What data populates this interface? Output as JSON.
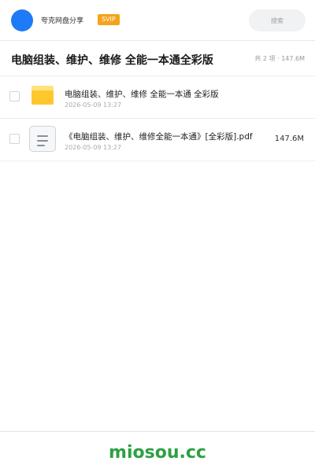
{
  "header": {
    "brand": "夸克网盘分享",
    "badge": "SVIP",
    "search_placeholder": "搜索"
  },
  "share": {
    "title": "电脑组装、维护、维修 全能一本通全彩版",
    "summary": "共 2 项 · 147.6M"
  },
  "files": [
    {
      "type": "folder",
      "name": "电脑组装、维护、维修 全能一本通 全彩版",
      "time": "2026-05-09 13:27",
      "size": ""
    },
    {
      "type": "document",
      "name": "《电脑组装、维护、维修全能一本通》[全彩版].pdf",
      "time": "2026-05-09 13:27",
      "size": "147.6M"
    }
  ],
  "footer": {
    "site": "miosou.cc"
  },
  "colors": {
    "accent": "#1e7bf7",
    "svip": "#f5a31a",
    "folder": "#ffc72e",
    "footer_link": "#2ea043"
  },
  "icons": {
    "avatar": "circle-avatar",
    "folder": "folder-icon",
    "document": "document-icon"
  }
}
